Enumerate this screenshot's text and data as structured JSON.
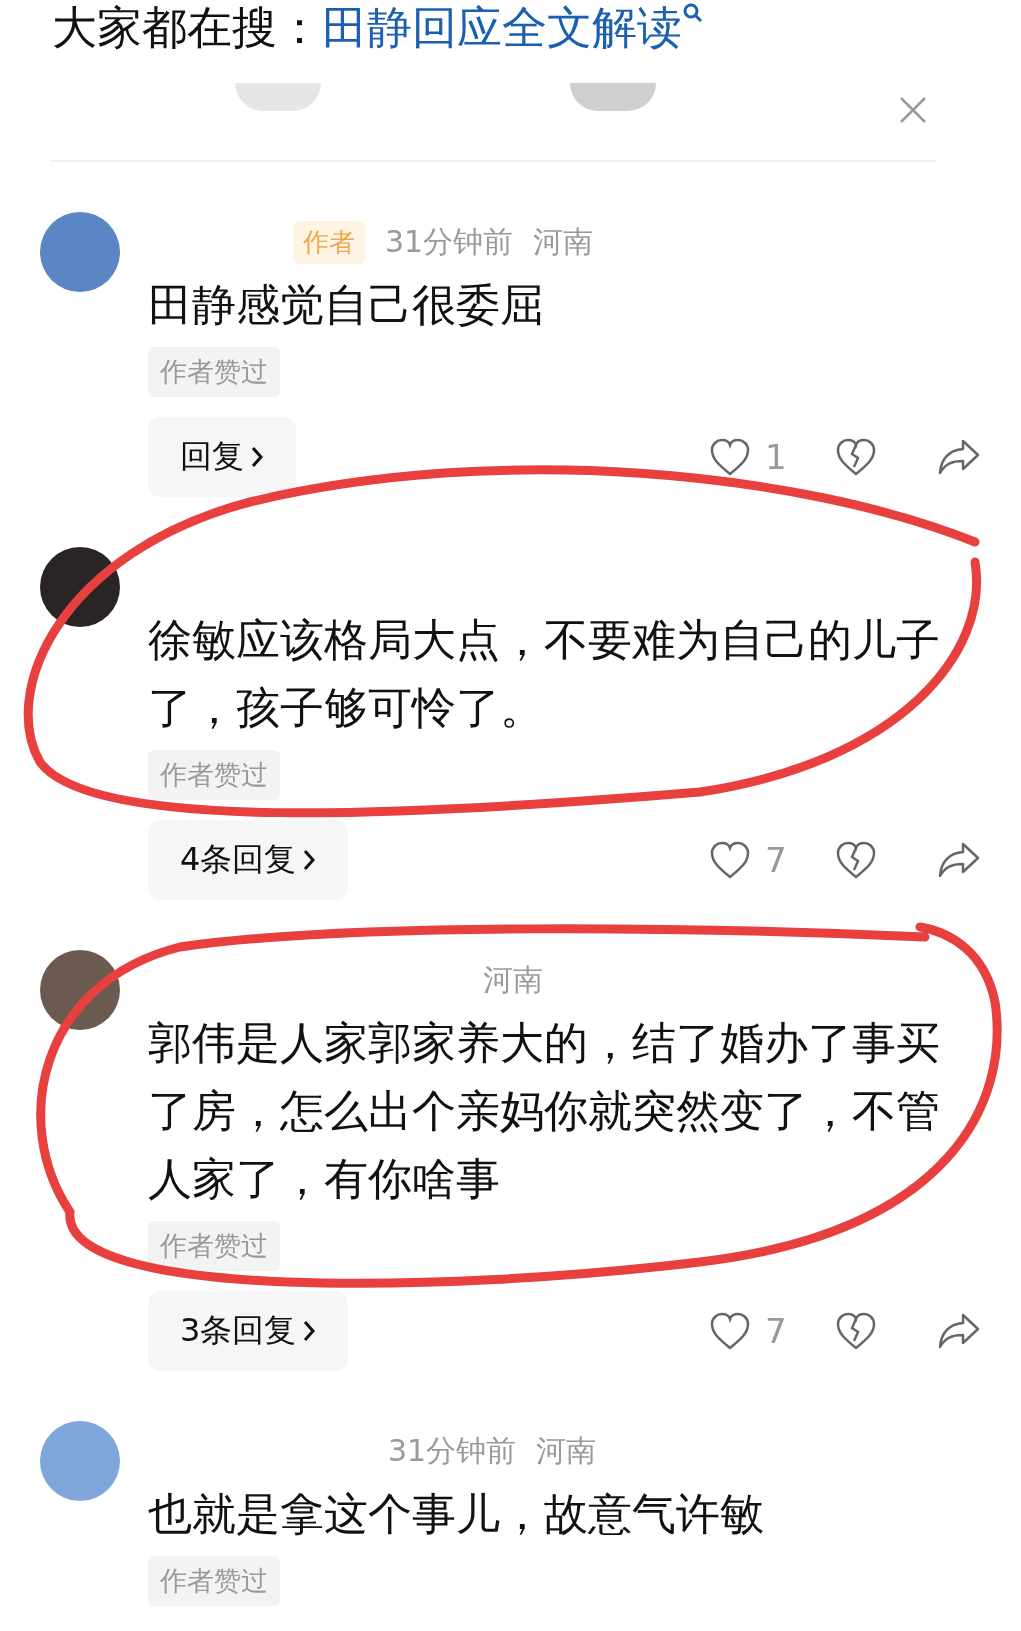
{
  "trending": {
    "label": "大家都在搜：",
    "query": "田静回应全文解读"
  },
  "comments": [
    {
      "color": "#5b86c4",
      "meta": {
        "author_tag": "作者",
        "time": "31分钟前",
        "region": "河南"
      },
      "text": "田静感觉自己很委屈",
      "author_liked": "作者赞过",
      "reply_button": "回复",
      "likes": "1",
      "circled": false
    },
    {
      "color": "#2a2424",
      "text": "徐敏应该格局大点，不要难为自己的儿子了，孩子够可怜了。",
      "author_liked": "作者赞过",
      "reply_button": "4条回复",
      "likes": "7",
      "circled": true
    },
    {
      "color": "#6b5a50",
      "meta": {
        "region": "河南"
      },
      "text": "郭伟是人家郭家养大的，结了婚办了事买了房，怎么出个亲妈你就突然变了，不管人家了，有你啥事",
      "author_liked": "作者赞过",
      "reply_button": "3条回复",
      "likes": "7",
      "circled": true
    },
    {
      "color": "#7fa6d8",
      "meta": {
        "time": "31分钟前",
        "region": "河南"
      },
      "text": "也就是拿这个事儿，故意气许敏",
      "author_liked": "作者赞过",
      "circled": false
    }
  ]
}
